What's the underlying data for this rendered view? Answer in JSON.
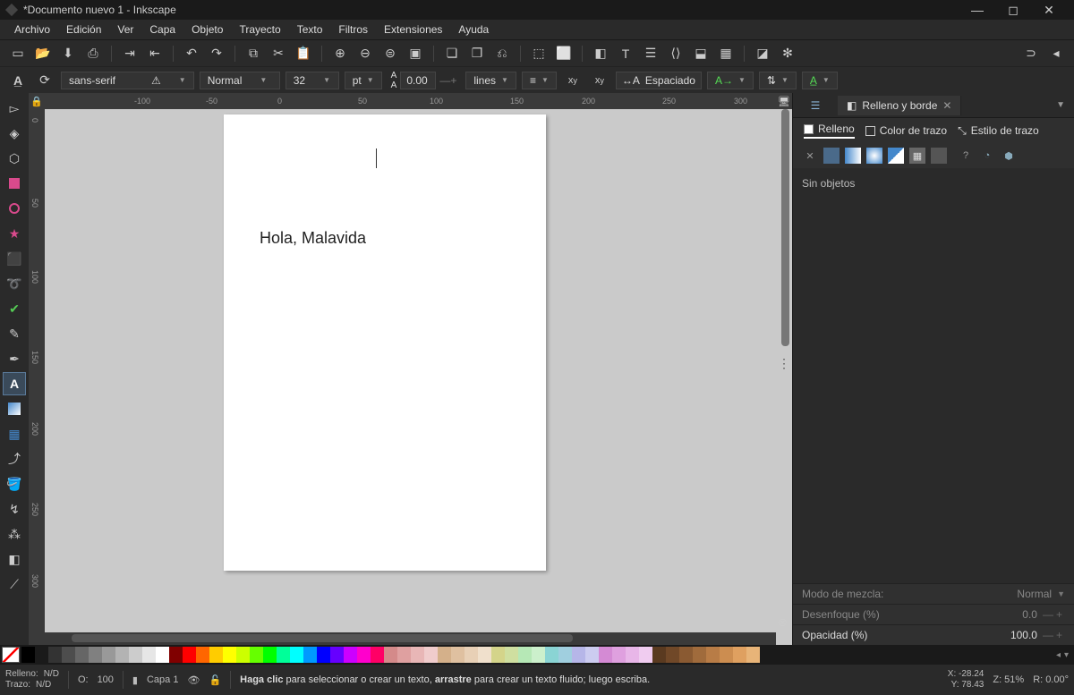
{
  "titlebar": {
    "title": "*Documento nuevo 1 - Inkscape"
  },
  "menubar": [
    "Archivo",
    "Edición",
    "Ver",
    "Capa",
    "Objeto",
    "Trayecto",
    "Texto",
    "Filtros",
    "Extensiones",
    "Ayuda"
  ],
  "texttool": {
    "font": "sans-serif",
    "style": "Normal",
    "size": "32",
    "unit": "pt",
    "spacing": "0.00",
    "mode": "lines",
    "btn_spacing": "Espaciado"
  },
  "canvas": {
    "ruler_h": [
      {
        "v": "-100",
        "p": 100
      },
      {
        "v": "-50",
        "p": 180
      },
      {
        "v": "0",
        "p": 260
      },
      {
        "v": "50",
        "p": 350
      },
      {
        "v": "100",
        "p": 430
      },
      {
        "v": "150",
        "p": 520
      },
      {
        "v": "200",
        "p": 600
      },
      {
        "v": "250",
        "p": 690
      },
      {
        "v": "300",
        "p": 770
      }
    ],
    "ruler_v": [
      {
        "v": "0",
        "p": 10
      },
      {
        "v": "50",
        "p": 100
      },
      {
        "v": "100",
        "p": 180
      },
      {
        "v": "150",
        "p": 270
      },
      {
        "v": "200",
        "p": 350
      },
      {
        "v": "250",
        "p": 440
      },
      {
        "v": "300",
        "p": 520
      }
    ],
    "text": "Hola, Malavida"
  },
  "rightpanel": {
    "tab_label": "Relleno y borde",
    "sub_fill": "Relleno",
    "sub_stroke": "Color de trazo",
    "sub_style": "Estilo de trazo",
    "noobj": "Sin objetos",
    "blend_label": "Modo de mezcla:",
    "blend_value": "Normal",
    "blur_label": "Desenfoque (%)",
    "blur_value": "0.0",
    "opacity_label": "Opacidad (%)",
    "opacity_value": "100.0"
  },
  "palette": [
    "#000000",
    "#1a1a1a",
    "#333333",
    "#4d4d4d",
    "#666666",
    "#808080",
    "#999999",
    "#b3b3b3",
    "#cccccc",
    "#e6e6e6",
    "#ffffff",
    "#800000",
    "#ff0000",
    "#ff6600",
    "#ffcc00",
    "#ffff00",
    "#ccff00",
    "#66ff00",
    "#00ff00",
    "#00ff99",
    "#00ffff",
    "#0099ff",
    "#0000ff",
    "#6600ff",
    "#cc00ff",
    "#ff00cc",
    "#ff0066",
    "#d48a8a",
    "#dfa0a0",
    "#e8b6b6",
    "#f0cccc",
    "#d4b08a",
    "#dfc0a0",
    "#e8d0b6",
    "#f0e0cc",
    "#d4d48a",
    "#cfdfA0",
    "#b6e8b6",
    "#ccf0cc",
    "#8ad4d4",
    "#a0cfdf",
    "#b6b6e8",
    "#ccccf0",
    "#d48ad4",
    "#dfa0df",
    "#e8b6e8",
    "#f0ccf0",
    "#5a3a20",
    "#704828",
    "#8a5a32",
    "#a06b3c",
    "#b87c46",
    "#cc8d50",
    "#dfa060",
    "#e8b478"
  ],
  "status": {
    "fill_label": "Relleno:",
    "stroke_label": "Trazo:",
    "fill_val": "N/D",
    "stroke_val": "N/D",
    "o_label": "O:",
    "o_val": "100",
    "layer": "Capa 1",
    "hint_pre": "Haga clic",
    "hint_mid1": " para seleccionar o crear un texto, ",
    "hint_bold2": "arrastre",
    "hint_mid2": " para crear un texto fluido; luego escriba.",
    "x_label": "X:",
    "x_val": "-28.24",
    "y_label": "Y:",
    "y_val": "78.43",
    "z_label": "Z:",
    "z_val": "51%",
    "r_label": "R:",
    "r_val": "0.00°"
  }
}
